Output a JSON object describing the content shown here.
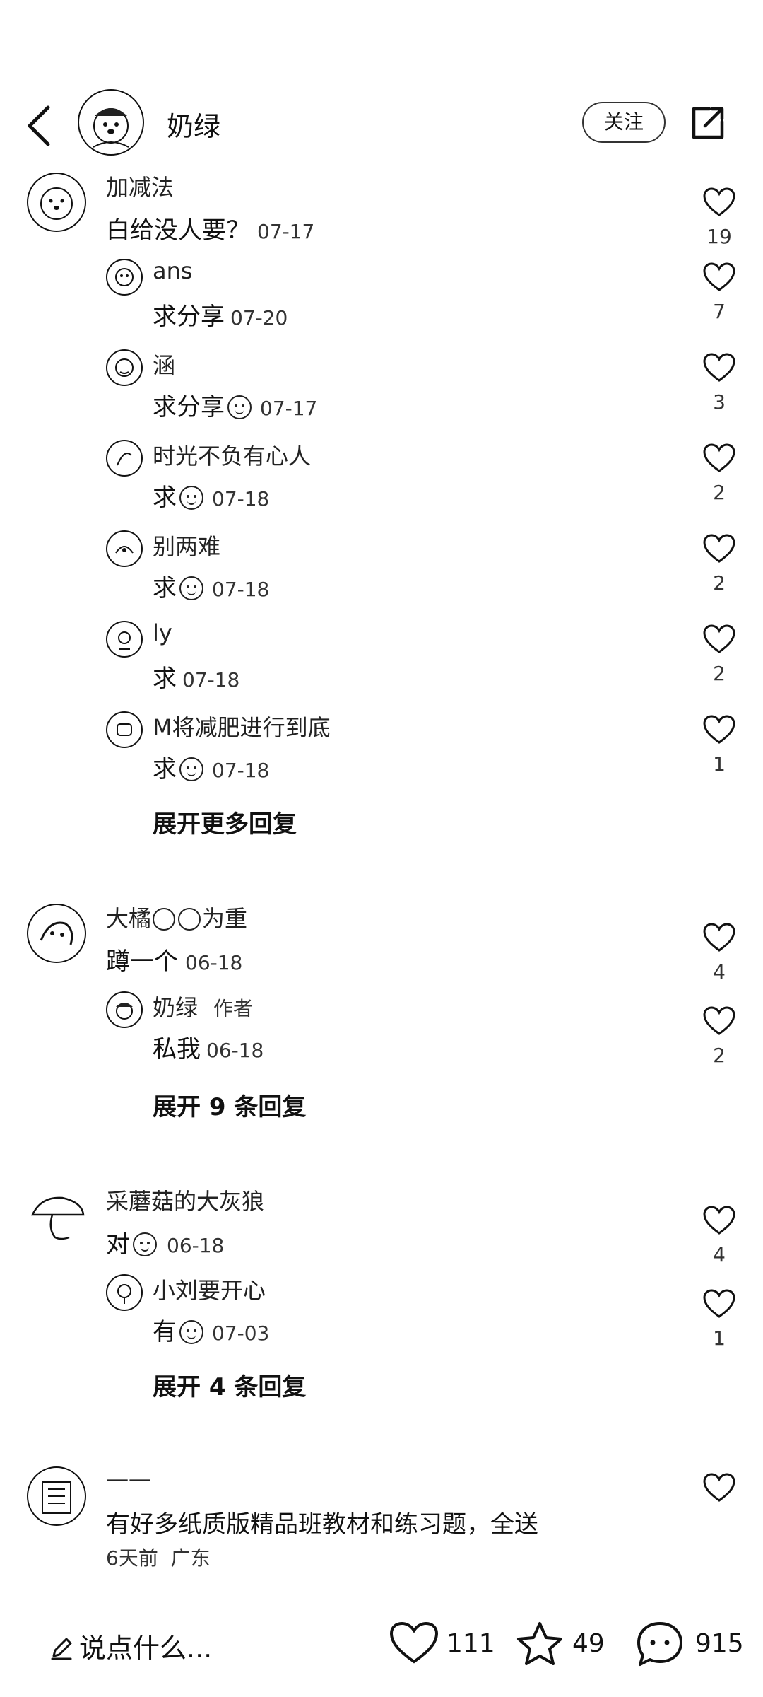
{
  "header": {
    "title": "奶绿",
    "follow_label": "关注",
    "back_icon": "chevron-left-icon",
    "share_icon": "external-share-icon"
  },
  "comments": [
    {
      "user": "加减法",
      "text": "白给没人要？",
      "time": "07-17",
      "likes": "19",
      "replies": [
        {
          "user": "ans",
          "text": "求分享",
          "time": "07-20",
          "likes": "7",
          "emoji": false
        },
        {
          "user": "涵",
          "text": "求分享",
          "time": "07-17",
          "likes": "3",
          "emoji": true
        },
        {
          "user": "时光不负有心人",
          "text": "求",
          "time": "07-18",
          "likes": "2",
          "emoji": true
        },
        {
          "user": "别两难",
          "text": "求",
          "time": "07-18",
          "likes": "2",
          "emoji": true
        },
        {
          "user": "ly",
          "text": "求",
          "time": "07-18",
          "likes": "2",
          "emoji": false
        },
        {
          "user": "M将减肥进行到底",
          "text": "求",
          "time": "07-18",
          "likes": "1",
          "emoji": true
        }
      ],
      "expand_label": "展开更多回复"
    },
    {
      "user_prefix": "大橘",
      "user_suffix": "为重",
      "text": "蹲一个",
      "time": "06-18",
      "likes": "4",
      "replies": [
        {
          "user": "奶绿",
          "author_tag": "作者",
          "text": "私我",
          "time": "06-18",
          "likes": "2"
        }
      ],
      "expand_label": "展开 9 条回复"
    },
    {
      "user": "采蘑菇的大灰狼",
      "text": "对",
      "time": "06-18",
      "likes": "4",
      "replies": [
        {
          "user": "小刘要开心",
          "text": "有",
          "time": "07-03",
          "likes": "1"
        }
      ],
      "expand_label": "展开 4 条回复"
    },
    {
      "user": "一一",
      "text": "有好多纸质版精品班教材和练习题，全送",
      "meta": "6天前  广东",
      "likes": ""
    }
  ],
  "bottom": {
    "input_placeholder": "说点什么...",
    "likes": "111",
    "stars": "49",
    "comments": "915"
  }
}
